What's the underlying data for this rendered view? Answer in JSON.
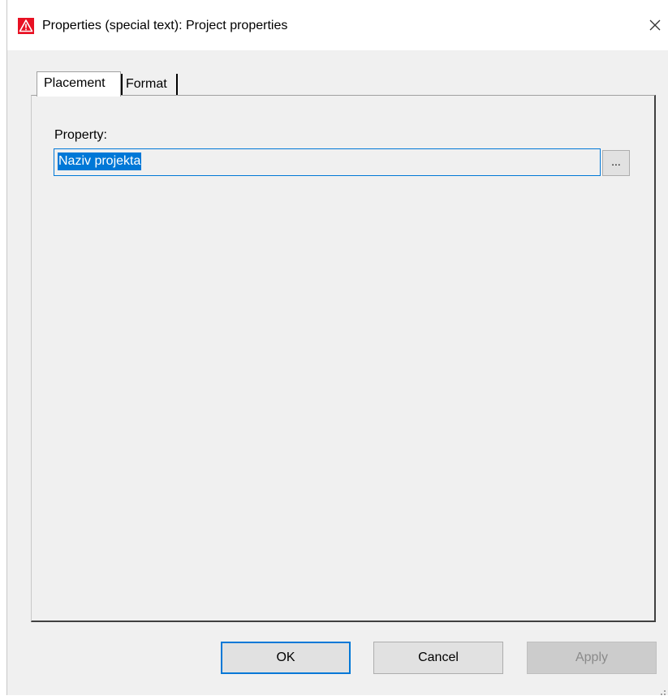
{
  "window": {
    "title": "Properties (special text): Project properties",
    "app_icon": "warning-triangle-icon",
    "close_icon": "close-icon",
    "accent_color": "#0078d7",
    "icon_color": "#e81123"
  },
  "tabs": [
    {
      "label": "Placement",
      "selected": true
    },
    {
      "label": "Format",
      "selected": false
    }
  ],
  "placement": {
    "property_label": "Property:",
    "property_value": "Naziv projekta",
    "browse_label": "..."
  },
  "buttons": {
    "ok": "OK",
    "cancel": "Cancel",
    "apply": "Apply"
  }
}
